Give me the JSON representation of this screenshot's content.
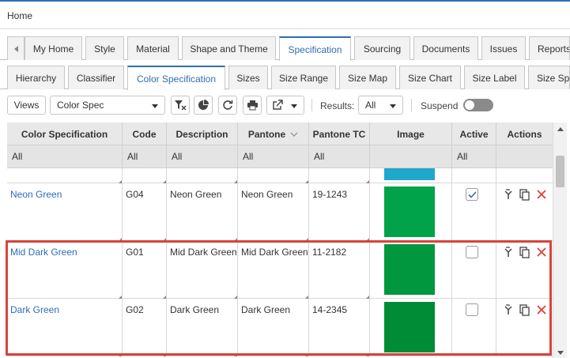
{
  "breadcrumb": "Home",
  "main_tabs": [
    "My Home",
    "Style",
    "Material",
    "Shape and Theme",
    "Specification",
    "Sourcing",
    "Documents",
    "Issues",
    "Reports"
  ],
  "sub_tabs": [
    "Hierarchy",
    "Classifier",
    "Color Specification",
    "Sizes",
    "Size Range",
    "Size Map",
    "Size Chart",
    "Size Label",
    "Size Spe"
  ],
  "toolbar": {
    "views_label": "Views",
    "view_select": "Color Spec",
    "results_label": "Results:",
    "results_value": "All",
    "suspend_label": "Suspend"
  },
  "grid": {
    "columns": [
      "Color Specification",
      "Code",
      "Description",
      "Pantone",
      "Pantone TC",
      "Image",
      "Active",
      "Actions"
    ],
    "filters": [
      "All",
      "All",
      "All",
      "All",
      "All",
      "",
      "All",
      ""
    ],
    "rows": [
      {
        "name": "Neon Green",
        "code": "G04",
        "description": "Neon Green",
        "pantone": "Neon Green",
        "pantone_tc": "19-1243",
        "color": "#00a24a",
        "active": true
      },
      {
        "name": "Mid Dark Green",
        "code": "G01",
        "description": "Mid Dark Green",
        "pantone": "Mid Dark Green",
        "pantone_tc": "11-2182",
        "color": "#00973f",
        "active": false
      },
      {
        "name": "Dark Green",
        "code": "G02",
        "description": "Dark Green",
        "pantone": "Dark Green",
        "pantone_tc": "14-2345",
        "color": "#008c36",
        "active": false
      }
    ],
    "partial_swatch_color": "#1ea8cc"
  },
  "colors": {
    "accent": "#2f6db5",
    "highlight_border": "#d9433b",
    "delete_icon": "#d9433b"
  }
}
